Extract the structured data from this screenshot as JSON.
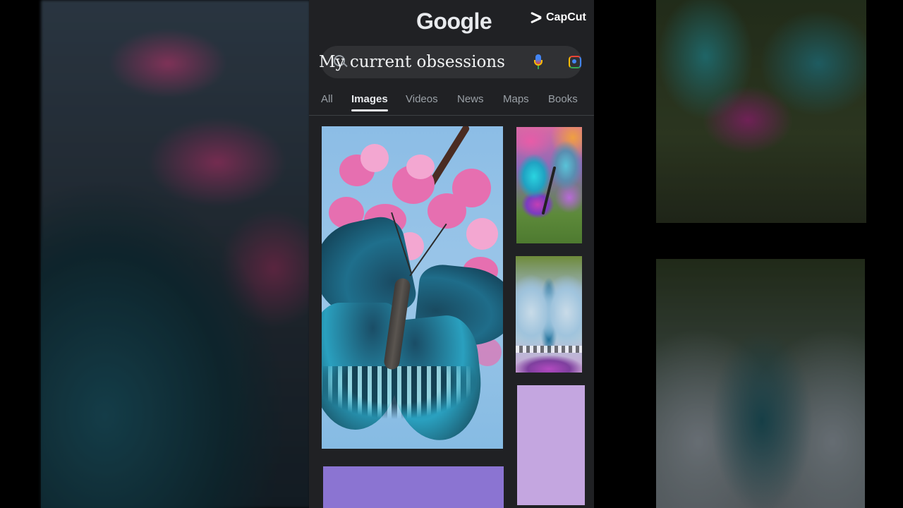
{
  "app": {
    "logo": "Google",
    "watermark": "CapCut"
  },
  "search": {
    "query": "My current obsessions"
  },
  "tabs": [
    {
      "label": "All",
      "active": false
    },
    {
      "label": "Images",
      "active": true
    },
    {
      "label": "Videos",
      "active": false
    },
    {
      "label": "News",
      "active": false
    },
    {
      "label": "Maps",
      "active": false
    },
    {
      "label": "Books",
      "active": false
    }
  ],
  "results": [
    {
      "kind": "image",
      "subject": "blue butterfly on pink blossoms"
    },
    {
      "kind": "image",
      "subject": "colorful butterfly"
    },
    {
      "kind": "image",
      "subject": "pale blue butterfly"
    },
    {
      "kind": "color-swatch",
      "color": "#8b74d2"
    },
    {
      "kind": "color-swatch",
      "color": "#c4a6e0"
    }
  ],
  "colors": {
    "background": "#202124",
    "search_bar": "#303134",
    "active_tab": "#e8eaed",
    "inactive_tab": "#9aa0a6"
  }
}
